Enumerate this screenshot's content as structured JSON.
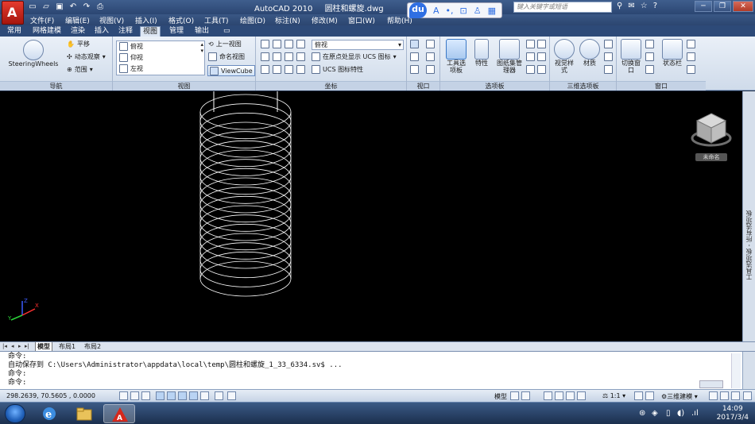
{
  "titlebar": {
    "app": "AutoCAD 2010",
    "file": "圆柱和螺旋.dwg",
    "search_placeholder": "键入关键字或短语"
  },
  "ime": {
    "logo": "du",
    "mode": "A"
  },
  "menu": [
    "文件(F)",
    "编辑(E)",
    "视图(V)",
    "插入(I)",
    "格式(O)",
    "工具(T)",
    "绘图(D)",
    "标注(N)",
    "修改(M)",
    "窗口(W)",
    "帮助(H)"
  ],
  "ribbon_tabs": [
    "常用",
    "网格建模",
    "渲染",
    "插入",
    "注释",
    "视图",
    "管理",
    "输出"
  ],
  "active_tab": "视图",
  "ribbon": {
    "nav": {
      "title": "导航",
      "steering": "SteeringWheels",
      "pan": "平移",
      "orbit": "动态观察",
      "extent": "范围"
    },
    "views": {
      "title": "视图",
      "items": [
        "俯视",
        "仰视",
        "左视"
      ],
      "prev": "上一视图",
      "named": "命名视图",
      "viewcube": "ViewCube"
    },
    "coords": {
      "title": "坐标",
      "select": "俯视",
      "origin": "在原点处显示 UCS 图标",
      "ucs_prop": "UCS 图标特性"
    },
    "viewport": {
      "title": "视口"
    },
    "palettes": {
      "title": "选项板",
      "tool": "工具选项板",
      "props": "特性",
      "sheets": "图纸集管理器"
    },
    "palettes3d": {
      "title": "三维选项板",
      "visual": "视觉样式",
      "material": "材质"
    },
    "window": {
      "title": "窗口",
      "switch": "切换窗口",
      "status": "状态栏"
    }
  },
  "viewcube": {
    "label": "未命名"
  },
  "right_tab": "工具选项板 - 所有选项板",
  "layout_tabs": [
    "模型",
    "布局1",
    "布局2"
  ],
  "command": {
    "lines": [
      "命令:",
      "自动保存到 C:\\Users\\Administrator\\appdata\\local\\temp\\圆柱和螺旋_1_33_6334.sv$ ...",
      "命令:",
      "命令:"
    ]
  },
  "status": {
    "coords": "298.2639, 70.5605 , 0.0000",
    "model": "模型",
    "scale": "1:1",
    "workspace": "三维建模"
  },
  "taskbar": {
    "time": "14:09",
    "date": "2017/3/4"
  },
  "colors": {
    "accent": "#2b4672",
    "drawing_bg": "#000000",
    "helix": "#ffffff"
  }
}
